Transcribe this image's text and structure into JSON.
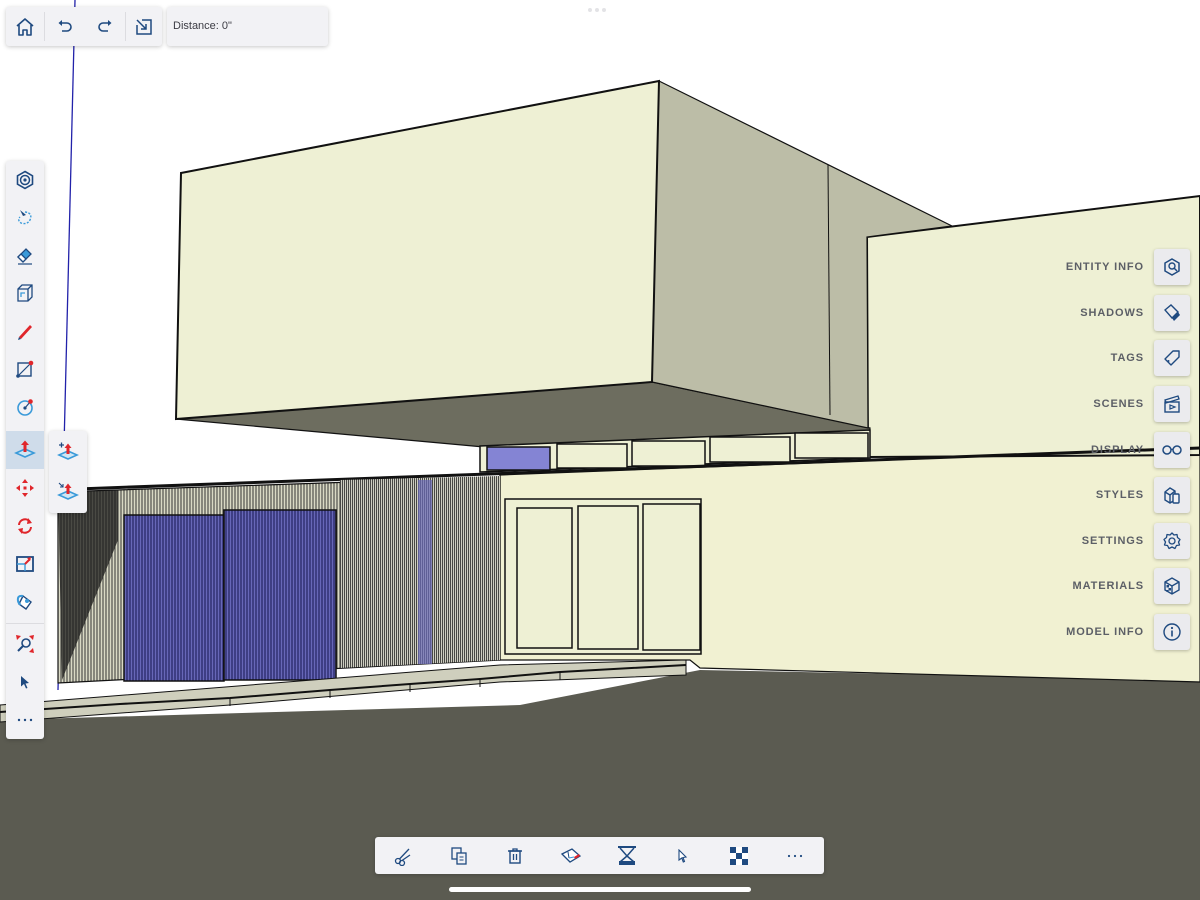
{
  "top_toolbar": {
    "buttons": [
      {
        "name": "home",
        "icon": "home-icon"
      },
      {
        "name": "undo",
        "icon": "undo-icon"
      },
      {
        "name": "redo",
        "icon": "redo-icon"
      },
      {
        "name": "zoom-extents",
        "icon": "zoom-extents-icon"
      }
    ],
    "distance_label": "Distance: 0\""
  },
  "left_toolbar": {
    "tools": [
      {
        "name": "orbit",
        "icon": "orbit-icon"
      },
      {
        "name": "lasso-select",
        "icon": "lasso-select-icon"
      },
      {
        "name": "eraser",
        "icon": "eraser-icon"
      },
      {
        "name": "section-plane",
        "icon": "section-plane-icon"
      },
      {
        "name": "pencil",
        "icon": "pencil-icon"
      },
      {
        "name": "rectangle",
        "icon": "rectangle-icon"
      },
      {
        "name": "circle",
        "icon": "circle-icon"
      },
      {
        "name": "push-pull",
        "icon": "push-pull-icon",
        "active": true
      },
      {
        "name": "move",
        "icon": "move-icon"
      },
      {
        "name": "rotate",
        "icon": "rotate-icon"
      },
      {
        "name": "offset",
        "icon": "offset-icon"
      },
      {
        "name": "paint-bucket",
        "icon": "paint-bucket-icon"
      },
      {
        "name": "zoom",
        "icon": "zoom-icon"
      },
      {
        "name": "select",
        "icon": "select-arrow-icon"
      },
      {
        "name": "more",
        "icon": "more-icon"
      }
    ],
    "flyout": [
      {
        "name": "push-pull-add",
        "icon": "push-pull-add-icon"
      },
      {
        "name": "push-pull-stretch",
        "icon": "push-pull-stretch-icon"
      }
    ]
  },
  "right_panel": {
    "items": [
      {
        "label": "ENTITY INFO",
        "icon": "entity-info-icon"
      },
      {
        "label": "SHADOWS",
        "icon": "shadows-icon"
      },
      {
        "label": "TAGS",
        "icon": "tag-icon"
      },
      {
        "label": "SCENES",
        "icon": "scenes-icon"
      },
      {
        "label": "DISPLAY",
        "icon": "glasses-icon"
      },
      {
        "label": "STYLES",
        "icon": "styles-icon"
      },
      {
        "label": "SETTINGS",
        "icon": "gear-icon"
      },
      {
        "label": "MATERIALS",
        "icon": "materials-icon"
      },
      {
        "label": "MODEL INFO",
        "icon": "info-icon"
      }
    ]
  },
  "bottom_toolbar": {
    "buttons": [
      {
        "name": "cut",
        "icon": "scissors-icon"
      },
      {
        "name": "copy",
        "icon": "copy-icon"
      },
      {
        "name": "delete",
        "icon": "trash-icon"
      },
      {
        "name": "make-component",
        "icon": "component-icon"
      },
      {
        "name": "hide",
        "icon": "hide-icon"
      },
      {
        "name": "select",
        "icon": "cursor-icon"
      },
      {
        "name": "materials",
        "icon": "checker-icon"
      },
      {
        "name": "more",
        "icon": "more-icon"
      }
    ]
  },
  "colors": {
    "icon_blue": "#1f4a80",
    "icon_red": "#e0262b",
    "icon_light_blue": "#3a9ad9",
    "face_light": "#eef0d4",
    "face_side": "#bcbda7",
    "face_dark": "#6d6d5f",
    "ground": "#5b5b51",
    "glass": "#8484d4",
    "screen_blue": "#3c3c8a"
  }
}
